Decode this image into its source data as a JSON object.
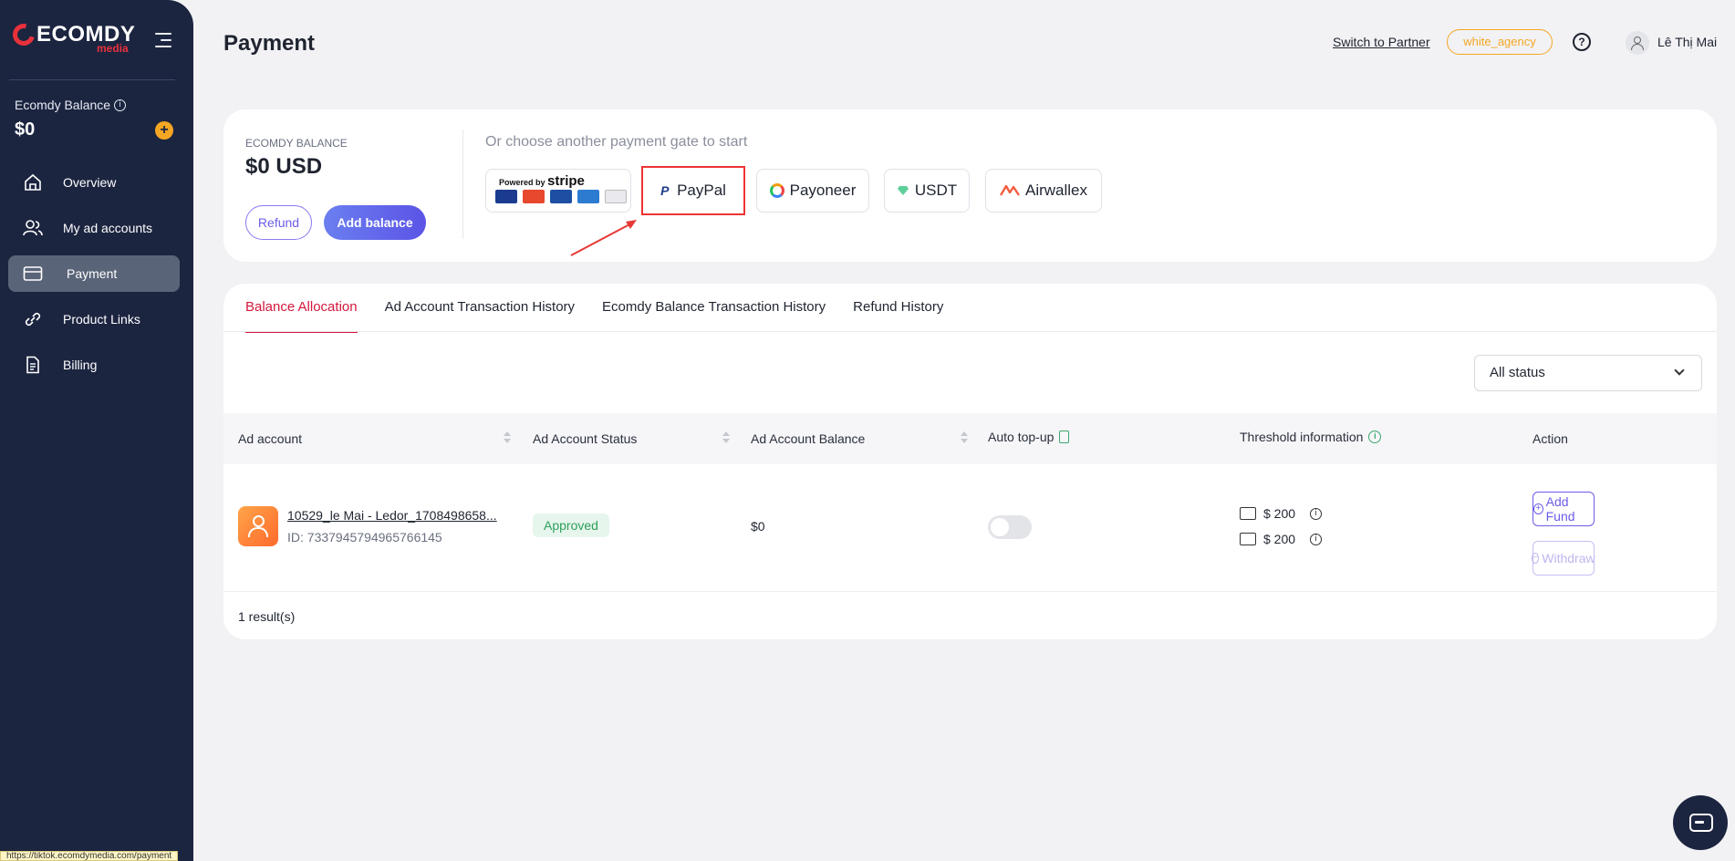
{
  "sidebar": {
    "logo_word": "ECOMDY",
    "logo_sub": "media",
    "balance_label": "Ecomdy Balance",
    "balance_value": "$0",
    "items": [
      {
        "label": "Overview",
        "icon": "home-icon"
      },
      {
        "label": "My ad accounts",
        "icon": "users-icon"
      },
      {
        "label": "Payment",
        "icon": "credit-card-icon",
        "active": true
      },
      {
        "label": "Product Links",
        "icon": "link-icon"
      },
      {
        "label": "Billing",
        "icon": "document-icon"
      }
    ]
  },
  "header": {
    "title": "Payment",
    "switch_link": "Switch to Partner",
    "agency_badge": "white_agency",
    "help_icon": "?",
    "user_name": "Lê Thị Mai"
  },
  "balance_card": {
    "label": "ECOMDY BALANCE",
    "value": "$0 USD",
    "refund_label": "Refund",
    "add_label": "Add balance",
    "gate_title": "Or choose another payment gate to start",
    "stripe_powered": "Powered by",
    "stripe_word": "stripe",
    "gates": [
      "PayPal",
      "Payoneer",
      "USDT",
      "Airwallex"
    ]
  },
  "tabs": [
    "Balance Allocation",
    "Ad Account Transaction History",
    "Ecomdy Balance Transaction History",
    "Refund History"
  ],
  "filter": {
    "status_value": "All status"
  },
  "table": {
    "columns": [
      "Ad account",
      "Ad Account Status",
      "Ad Account Balance",
      "Auto top-up",
      "Threshold information",
      "Action"
    ],
    "rows": [
      {
        "name": "10529_le Mai - Ledor_1708498658...",
        "id": "ID: 7337945794965766145",
        "status": "Approved",
        "balance": "$0",
        "threshold_1": "$ 200",
        "threshold_2": "$ 200",
        "add_fund": "Add Fund",
        "withdraw": "Withdraw"
      }
    ],
    "results": "1 result(s)"
  },
  "status_bar": "https://tiktok.ecomdymedia.com/payment",
  "colors": {
    "sidebar": "#1c2540",
    "accent": "#d3173c",
    "primary": "#6b5ce7",
    "badge": "#f5a623"
  }
}
